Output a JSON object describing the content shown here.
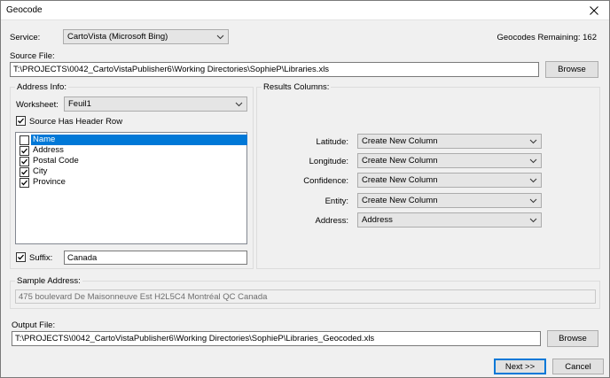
{
  "window": {
    "title": "Geocode"
  },
  "service": {
    "label": "Service:",
    "value": "CartoVista (Microsoft Bing)"
  },
  "geocodes_remaining": "Geocodes Remaining: 162",
  "source_file": {
    "label": "Source File:",
    "value": "T:\\PROJECTS\\0042_CartoVistaPublisher6\\Working Directories\\SophieP\\Libraries.xls",
    "browse": "Browse"
  },
  "address_info": {
    "label": "Address Info:",
    "worksheet_label": "Worksheet:",
    "worksheet_value": "Feuil1",
    "header_row_label": "Source Has Header Row",
    "header_row_checked": true,
    "fields": [
      {
        "label": "Name",
        "checked": false,
        "selected": true
      },
      {
        "label": "Address",
        "checked": true,
        "selected": false
      },
      {
        "label": "Postal Code",
        "checked": true,
        "selected": false
      },
      {
        "label": "City",
        "checked": true,
        "selected": false
      },
      {
        "label": "Province",
        "checked": true,
        "selected": false
      }
    ],
    "suffix_label": "Suffix:",
    "suffix_checked": true,
    "suffix_value": "Canada"
  },
  "results_columns": {
    "label": "Results Columns:",
    "rows": [
      {
        "label": "Latitude:",
        "value": "Create New Column"
      },
      {
        "label": "Longitude:",
        "value": "Create New Column"
      },
      {
        "label": "Confidence:",
        "value": "Create New Column"
      },
      {
        "label": "Entity:",
        "value": "Create New Column"
      },
      {
        "label": "Address:",
        "value": "Address"
      }
    ]
  },
  "sample_address": {
    "label": "Sample Address:",
    "value": "475  boulevard De Maisonneuve Est H2L5C4 Montréal QC Canada"
  },
  "output_file": {
    "label": "Output File:",
    "value": "T:\\PROJECTS\\0042_CartoVistaPublisher6\\Working Directories\\SophieP\\Libraries_Geocoded.xls",
    "browse": "Browse"
  },
  "footer": {
    "next": "Next >>",
    "cancel": "Cancel"
  }
}
